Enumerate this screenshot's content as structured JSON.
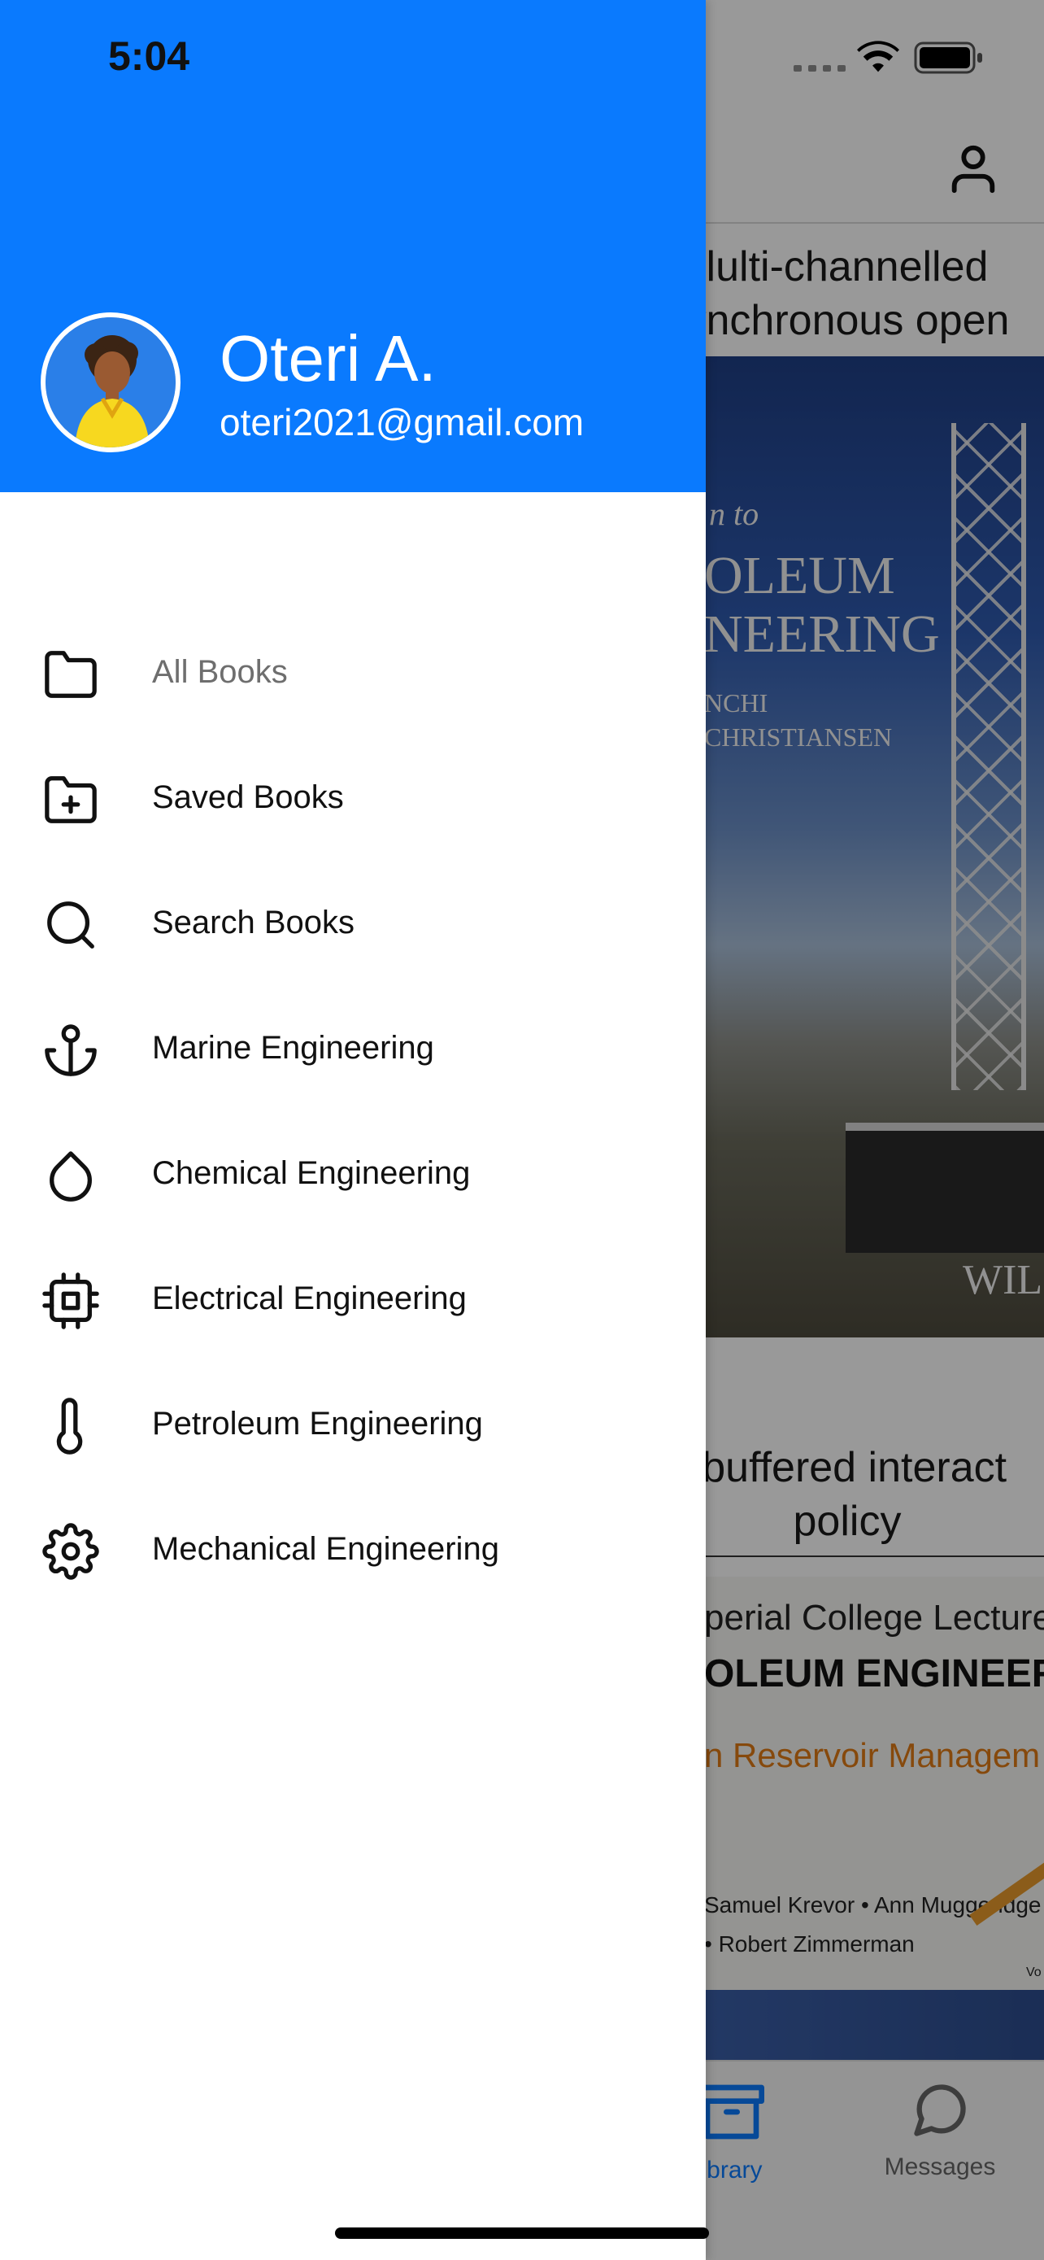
{
  "status_bar": {
    "time": "5:04"
  },
  "drawer": {
    "user": {
      "name": "Oteri A.",
      "email": "oteri2021@gmail.com"
    },
    "menu": [
      {
        "label": "All Books",
        "icon": "folder-icon",
        "active": true
      },
      {
        "label": "Saved Books",
        "icon": "folder-plus-icon"
      },
      {
        "label": "Search Books",
        "icon": "search-icon"
      },
      {
        "label": "Marine Engineering",
        "icon": "anchor-icon"
      },
      {
        "label": "Chemical Engineering",
        "icon": "droplet-icon"
      },
      {
        "label": "Electrical Engineering",
        "icon": "cpu-icon"
      },
      {
        "label": "Petroleum Engineering",
        "icon": "thermometer-icon"
      },
      {
        "label": "Mechanical Engineering",
        "icon": "settings-icon"
      }
    ]
  },
  "background": {
    "card1": {
      "title_line1": "lulti-channelled",
      "title_line2": "ynchronous open",
      "cover_text": [
        "n to",
        "OLEUM",
        "NEERING",
        "NCHI",
        "CHRISTIANSEN",
        "WIL"
      ]
    },
    "card2": {
      "title_line1": "-buffered interact",
      "title_line2": "policy",
      "cover_text": [
        "perial College Lecture",
        "OLEUM ENGINEER",
        "n Reservoir Managem",
        "Samuel Krevor • Ann Muggeridge",
        "• Robert Zimmerman",
        "Vo"
      ]
    },
    "tabs": [
      {
        "label": "ibrary",
        "icon": "archive-icon",
        "active": true
      },
      {
        "label": "Messages",
        "icon": "message-circle-icon"
      }
    ]
  },
  "colors": {
    "header_blue": "#0a7afe",
    "active_tab": "#0a7afe",
    "inactive_menu_text": "#6e6e6e",
    "cover_orange": "#e07b15"
  }
}
